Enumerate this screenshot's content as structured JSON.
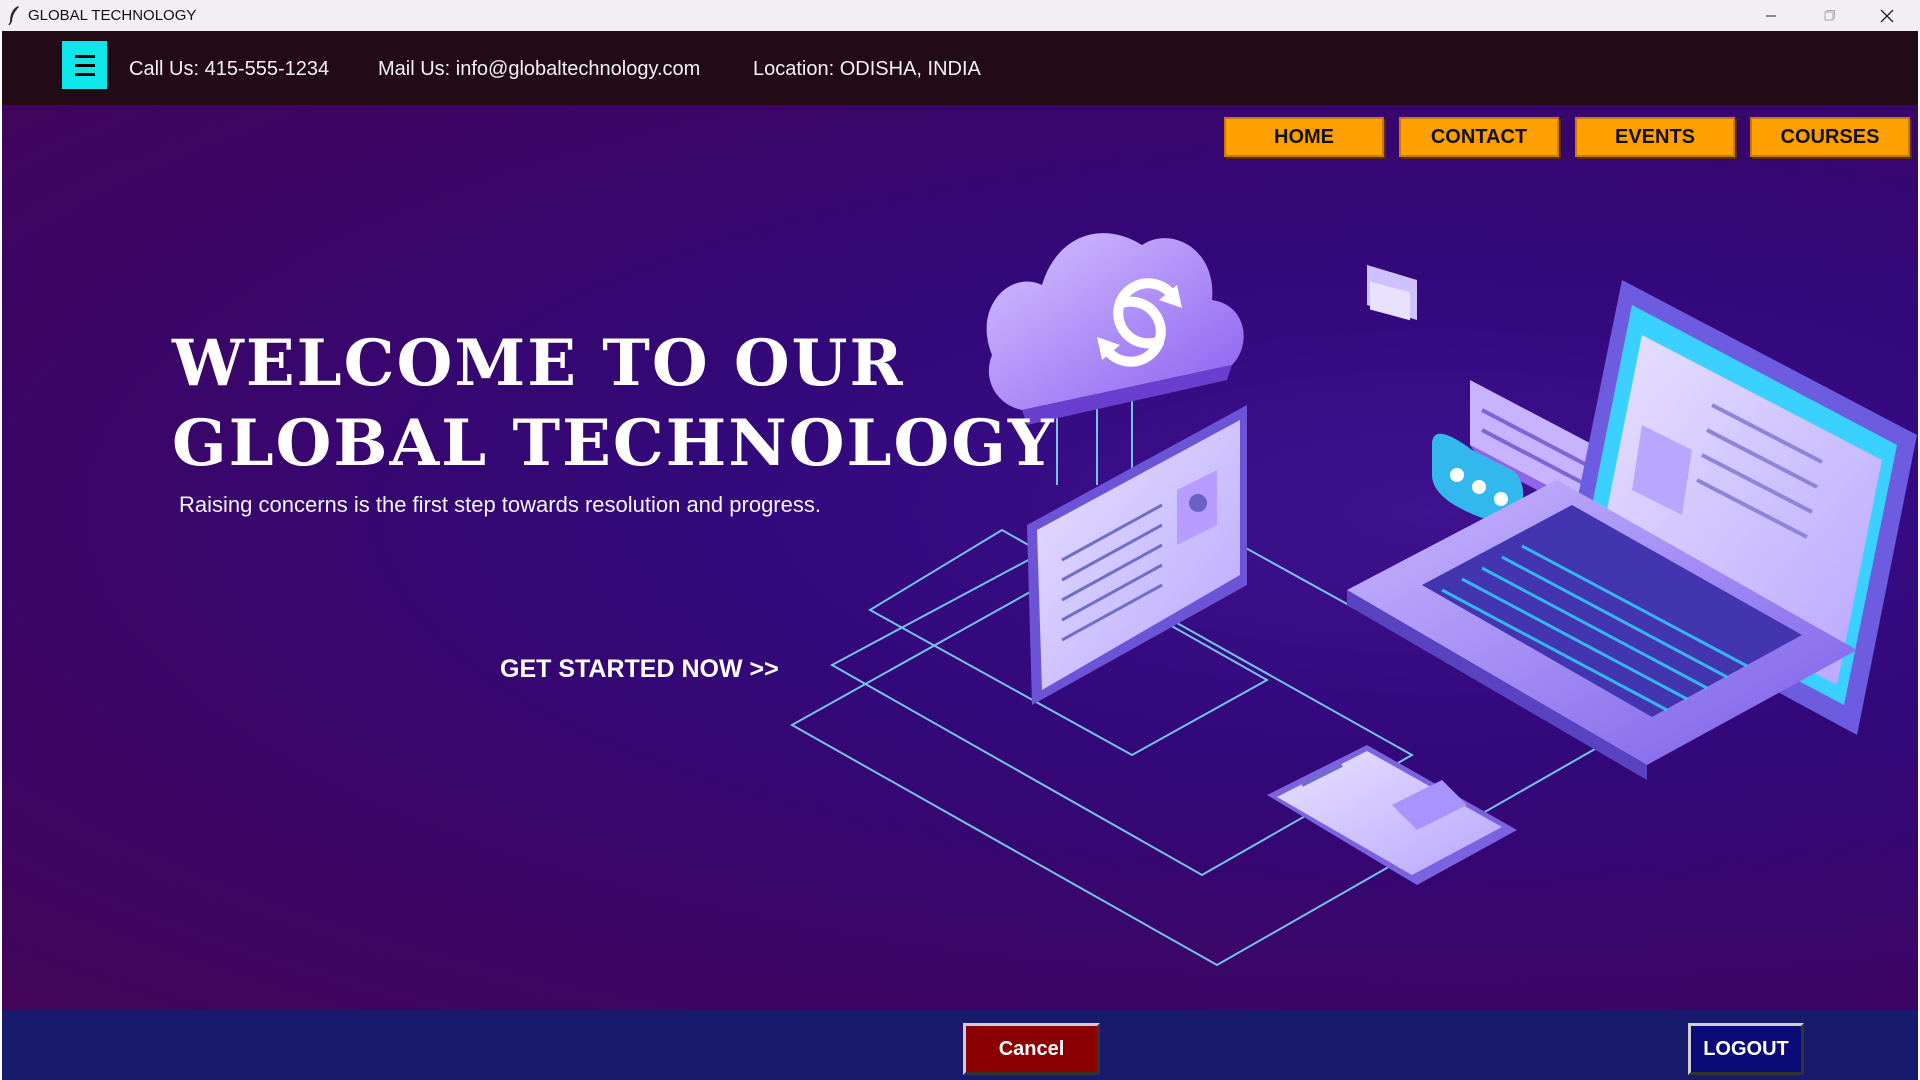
{
  "window": {
    "title": "GLOBAL TECHNOLOGY",
    "icon": "feather-icon",
    "controls": [
      "minimize-icon",
      "maximize-icon",
      "close-icon"
    ]
  },
  "infobar": {
    "menu_icon": "hamburger-icon",
    "call": "Call Us: 415-555-1234",
    "mail": "Mail Us: info@globaltechnology.com",
    "location": "Location: ODISHA, INDIA"
  },
  "nav": {
    "home": "HOME",
    "contact": "CONTACT",
    "events": "EVENTS",
    "courses": "COURSES"
  },
  "hero": {
    "headline_line1": "WELCOME TO OUR",
    "headline_line2": "GLOBAL TECHNOLOGY",
    "tagline": "Raising concerns is the first step towards resolution and progress.",
    "cta": "GET STARTED NOW >>"
  },
  "footer": {
    "cancel": "Cancel",
    "logout": "LOGOUT"
  },
  "colors": {
    "nav_button": "#ffa000",
    "hamburger": "#0fe6e9",
    "cancel": "#8b0000",
    "logout": "#0a0a78",
    "infobar": "#230a17",
    "bottombar": "#181a6e"
  }
}
